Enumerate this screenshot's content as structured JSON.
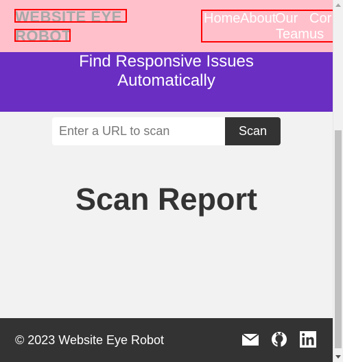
{
  "header": {
    "logo_line1": "WEBSITE EYE",
    "logo_line2": "ROBOT",
    "nav": {
      "home": "Home",
      "about": "About",
      "our": "Our",
      "team": "Team",
      "contact_partial": "Cor",
      "us": "us"
    }
  },
  "banner": {
    "line1": "Find Responsive Issues",
    "line2": "Automatically"
  },
  "scan": {
    "placeholder": "Enter a URL to scan",
    "button_label": "Scan"
  },
  "report": {
    "title": "Scan Report"
  },
  "footer": {
    "copyright": "© 2023 Website Eye Robot",
    "social": [
      "email-icon",
      "github-icon",
      "linkedin-icon"
    ]
  },
  "colors": {
    "header_bg": "#ffc0cb",
    "banner_bg": "#6a2ec3",
    "footer_bg": "#333333",
    "outline_red": "#ff0000",
    "logo_text": "#a8a8a8"
  }
}
